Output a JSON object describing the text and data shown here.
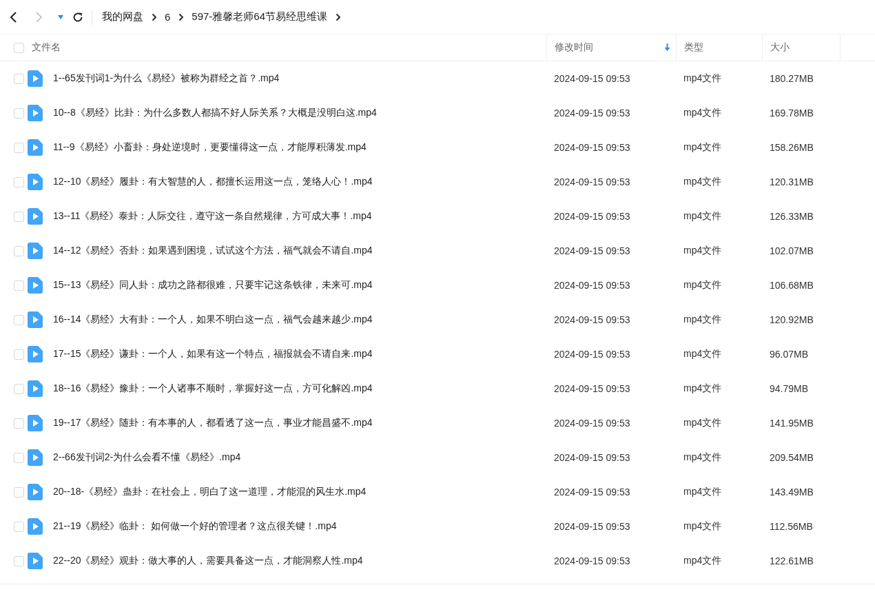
{
  "nav": {
    "back": {
      "disabled": false
    },
    "forward": {
      "disabled": true
    }
  },
  "breadcrumb": [
    "我的网盘",
    "6",
    "597-雅馨老师64节易经思维课"
  ],
  "table": {
    "select_all": {
      "checked": false
    },
    "columns": [
      {
        "label": "文件名",
        "sorted": false
      },
      {
        "label": "修改时间",
        "sorted": true
      },
      {
        "label": "类型",
        "sorted": false
      },
      {
        "label": "大小",
        "sorted": false
      }
    ],
    "rows": [
      {
        "checked": false,
        "name": "1--65发刊词1-为什么《易经》被称为群经之首？.mp4",
        "modified": "2024-09-15 09:53",
        "type": "mp4文件",
        "size": "180.27MB"
      },
      {
        "checked": false,
        "name": "10--8《易经》比卦：为什么多数人都搞不好人际关系？大概是没明白这.mp4",
        "modified": "2024-09-15 09:53",
        "type": "mp4文件",
        "size": "169.78MB"
      },
      {
        "checked": false,
        "name": "11--9《易经》小畜卦：身处逆境时，更要懂得这一点，才能厚积薄发.mp4",
        "modified": "2024-09-15 09:53",
        "type": "mp4文件",
        "size": "158.26MB"
      },
      {
        "checked": false,
        "name": "12--10《易经》履卦：有大智慧的人，都擅长运用这一点，笼络人心！.mp4",
        "modified": "2024-09-15 09:53",
        "type": "mp4文件",
        "size": "120.31MB"
      },
      {
        "checked": false,
        "name": "13--11《易经》泰卦：人际交往，遵守这一条自然规律，方可成大事！.mp4",
        "modified": "2024-09-15 09:53",
        "type": "mp4文件",
        "size": "126.33MB"
      },
      {
        "checked": false,
        "name": "14--12《易经》否卦：如果遇到困境，试试这个方法，福气就会不请自.mp4",
        "modified": "2024-09-15 09:53",
        "type": "mp4文件",
        "size": "102.07MB"
      },
      {
        "checked": false,
        "name": "15--13《易经》同人卦：成功之路都很难，只要牢记这条铁律，未来可.mp4",
        "modified": "2024-09-15 09:53",
        "type": "mp4文件",
        "size": "106.68MB"
      },
      {
        "checked": false,
        "name": "16--14《易经》大有卦：一个人，如果不明白这一点，福气会越来越少.mp4",
        "modified": "2024-09-15 09:53",
        "type": "mp4文件",
        "size": "120.92MB"
      },
      {
        "checked": false,
        "name": "17--15《易经》谦卦：一个人，如果有这一个特点，福报就会不请自来.mp4",
        "modified": "2024-09-15 09:53",
        "type": "mp4文件",
        "size": "96.07MB"
      },
      {
        "checked": false,
        "name": "18--16《易经》豫卦：一个人诸事不顺时，掌握好这一点，方可化解凶.mp4",
        "modified": "2024-09-15 09:53",
        "type": "mp4文件",
        "size": "94.79MB"
      },
      {
        "checked": false,
        "name": "19--17《易经》随卦：有本事的人，都看透了这一点，事业才能昌盛不.mp4",
        "modified": "2024-09-15 09:53",
        "type": "mp4文件",
        "size": "141.95MB"
      },
      {
        "checked": false,
        "name": "2--66发刊词2-为什么会看不懂《易经》.mp4",
        "modified": "2024-09-15 09:53",
        "type": "mp4文件",
        "size": "209.54MB"
      },
      {
        "checked": false,
        "name": "20--18-《易经》蛊卦：在社会上，明白了这一道理，才能混的风生水.mp4",
        "modified": "2024-09-15 09:53",
        "type": "mp4文件",
        "size": "143.49MB"
      },
      {
        "checked": false,
        "name": "21--19《易经》临卦： 如何做一个好的管理者？这点很关键！.mp4",
        "modified": "2024-09-15 09:53",
        "type": "mp4文件",
        "size": "112.56MB"
      },
      {
        "checked": false,
        "name": "22--20《易经》观卦：做大事的人，需要具备这一点，才能洞察人性.mp4",
        "modified": "2024-09-15 09:53",
        "type": "mp4文件",
        "size": "122.61MB"
      }
    ]
  }
}
